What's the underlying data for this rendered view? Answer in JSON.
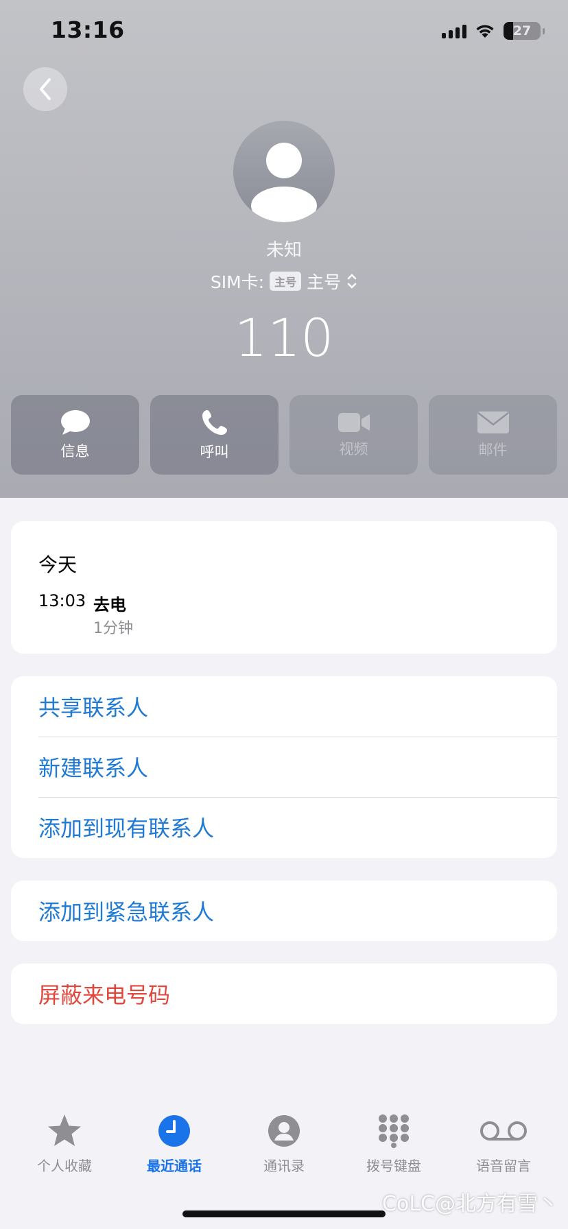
{
  "status_bar": {
    "time": "13:16",
    "battery": "27"
  },
  "contact": {
    "name": "未知",
    "sim_label": "SIM卡:",
    "sim_badge": "主号",
    "sim_value": "主号",
    "number": "110"
  },
  "actions": [
    {
      "label": "信息",
      "icon": "message-bubble-icon",
      "enabled": true
    },
    {
      "label": "呼叫",
      "icon": "phone-icon",
      "enabled": true
    },
    {
      "label": "视频",
      "icon": "video-camera-icon",
      "enabled": false
    },
    {
      "label": "邮件",
      "icon": "envelope-icon",
      "enabled": false
    }
  ],
  "recent": {
    "date": "今天",
    "time": "13:03",
    "type": "去电",
    "duration": "1分钟"
  },
  "options": {
    "share_contact": "共享联系人",
    "new_contact": "新建联系人",
    "add_existing": "添加到现有联系人",
    "add_emergency": "添加到紧急联系人",
    "block_caller": "屏蔽来电号码"
  },
  "tabs": [
    {
      "label": "个人收藏",
      "icon": "star-icon",
      "active": false
    },
    {
      "label": "最近通话",
      "icon": "clock-icon",
      "active": true
    },
    {
      "label": "通讯录",
      "icon": "person-circle-icon",
      "active": false
    },
    {
      "label": "拨号键盘",
      "icon": "keypad-icon",
      "active": false
    },
    {
      "label": "语音留言",
      "icon": "voicemail-icon",
      "active": false
    }
  ],
  "watermark": "CoLC@北方有雪丶",
  "colors": {
    "accent": "#1a73e8",
    "link": "#1f7ad6",
    "destructive": "#e0483d"
  }
}
